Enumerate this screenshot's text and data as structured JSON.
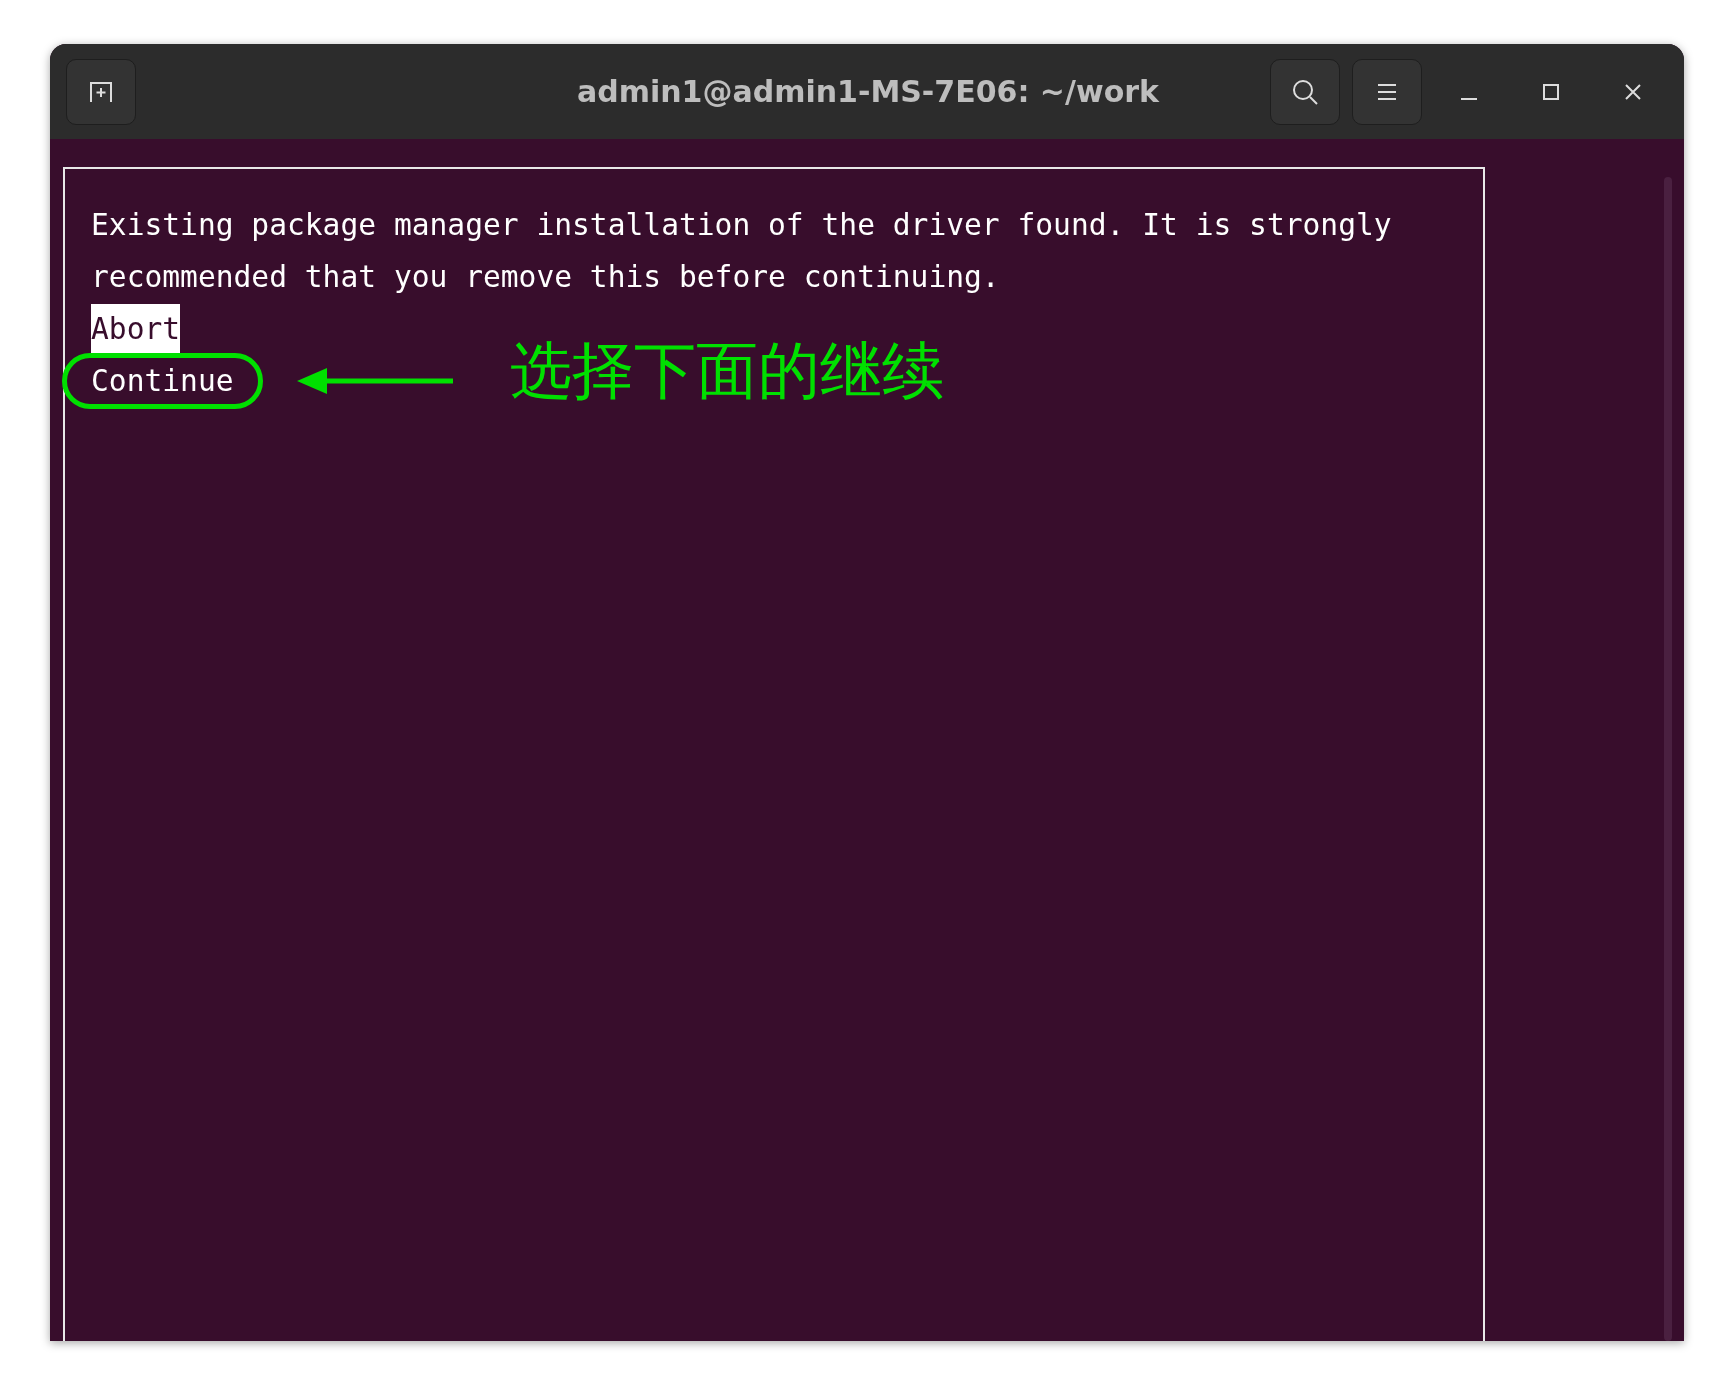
{
  "window": {
    "title": "admin1@admin1-MS-7E06: ~/work"
  },
  "dialog": {
    "message_lines": [
      "Existing package manager installation of the driver found. It is strongly",
      "recommended that you remove this before continuing."
    ],
    "options": [
      {
        "label": "Abort",
        "selected": true,
        "circled": false
      },
      {
        "label": "Continue",
        "selected": false,
        "circled": true
      }
    ]
  },
  "annotation": {
    "text": "选择下面的继续"
  }
}
